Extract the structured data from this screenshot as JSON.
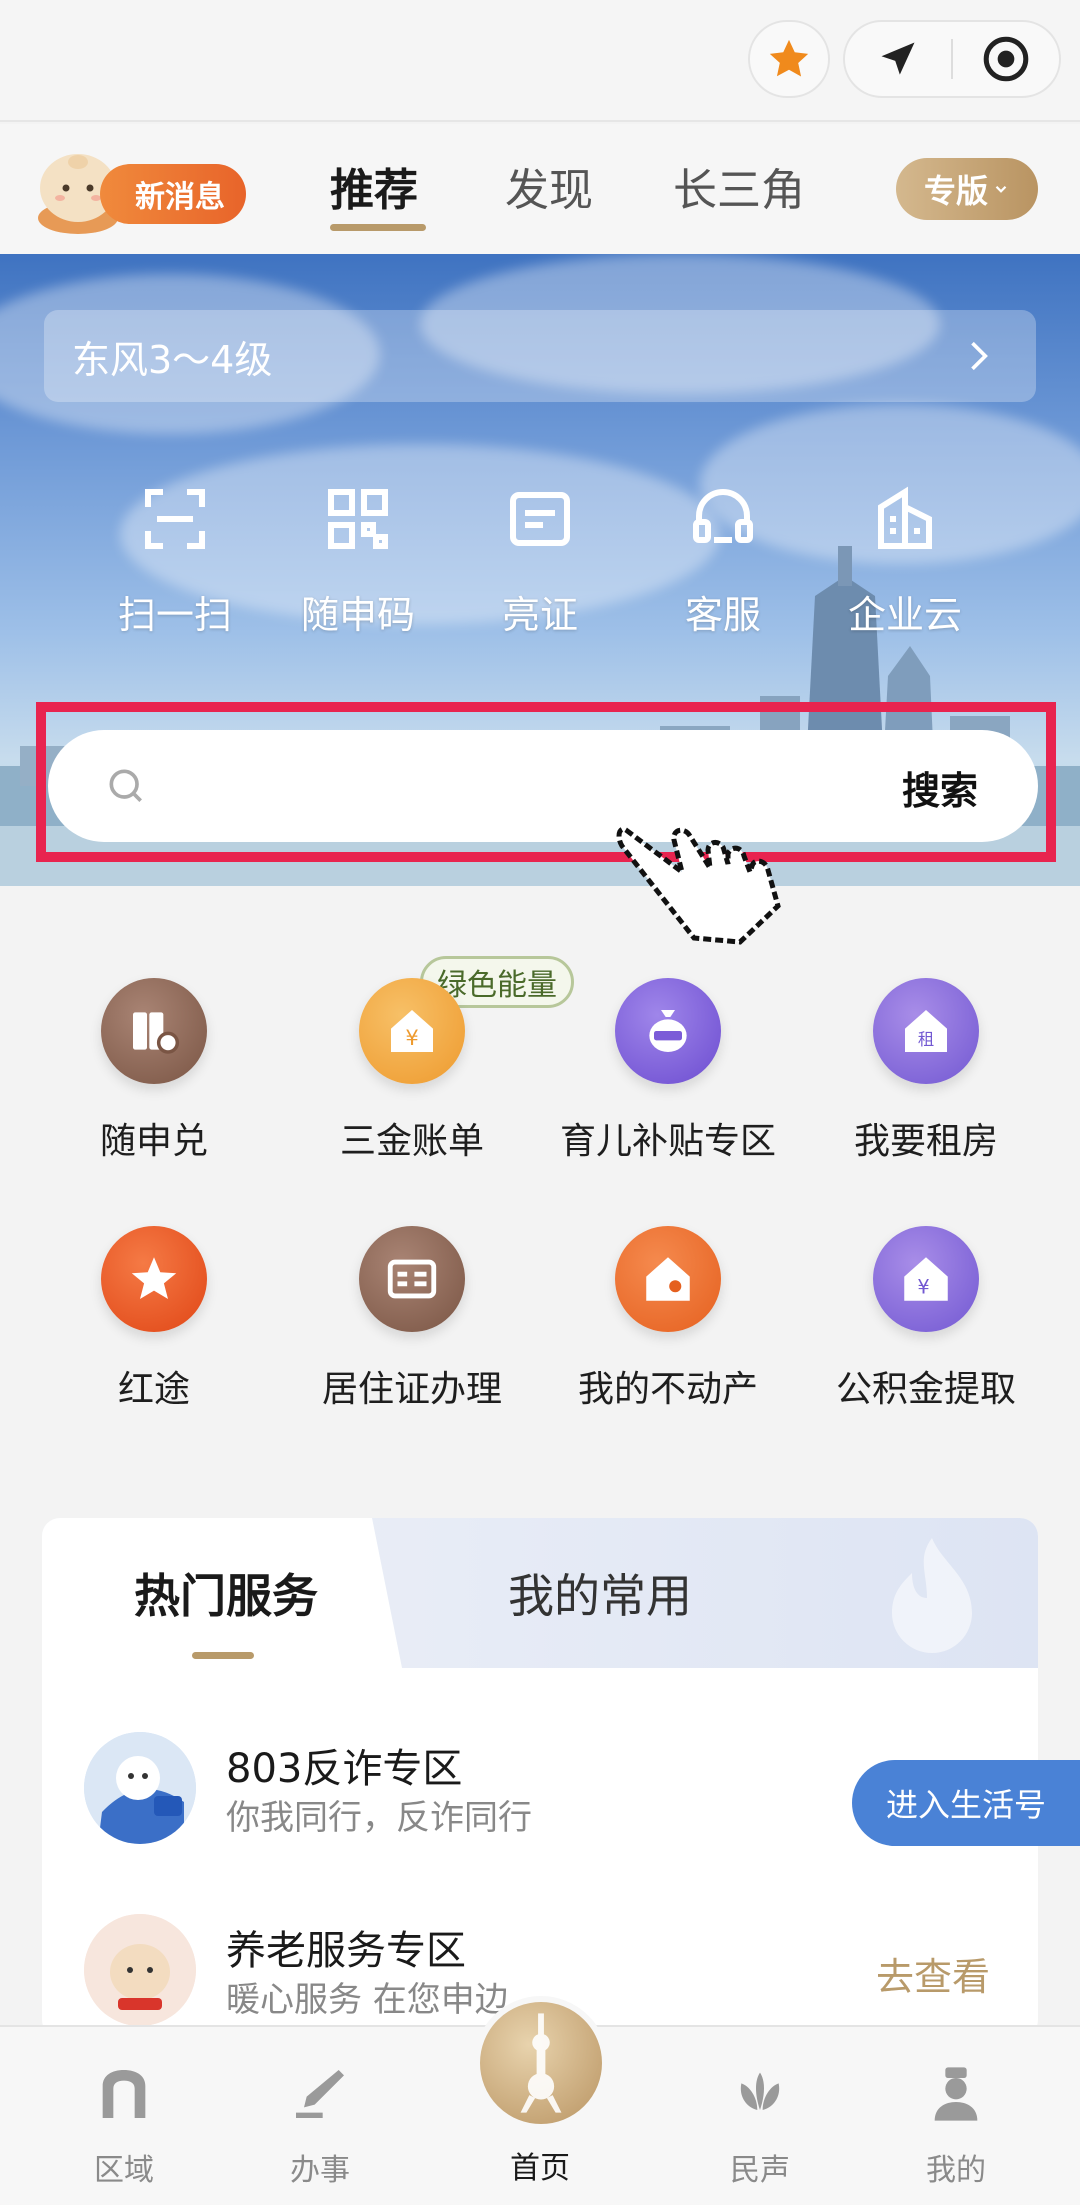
{
  "topbar": {
    "favorite_icon": "star-icon",
    "location_icon": "location-arrow-icon",
    "record_icon": "target-icon"
  },
  "header": {
    "new_message": "新消息",
    "tabs": [
      {
        "label": "推荐",
        "active": true
      },
      {
        "label": "发现",
        "active": false
      },
      {
        "label": "长三角",
        "active": false
      }
    ],
    "edition": "专版"
  },
  "hero": {
    "weather_text": "东风3～4级",
    "quick_actions": [
      {
        "label": "扫一扫",
        "icon": "scan-icon"
      },
      {
        "label": "随申码",
        "icon": "qr-code-icon"
      },
      {
        "label": "亮证",
        "icon": "card-icon"
      },
      {
        "label": "客服",
        "icon": "headset-icon"
      },
      {
        "label": "企业云",
        "icon": "building-icon"
      }
    ],
    "search_placeholder": "",
    "search_button": "搜索"
  },
  "services": {
    "badge": "绿色能量",
    "items": [
      {
        "label": "随申兑",
        "icon": "voucher-icon",
        "color": "#8a6350"
      },
      {
        "label": "三金账单",
        "icon": "yuan-house-icon",
        "color": "#f0a43a"
      },
      {
        "label": "育儿补贴专区",
        "icon": "money-bag-icon",
        "color": "#7e5fd6"
      },
      {
        "label": "我要租房",
        "icon": "rent-house-icon",
        "color": "#8a6ad8"
      },
      {
        "label": "红途",
        "icon": "red-star-icon",
        "color": "#e8501e"
      },
      {
        "label": "居住证办理",
        "icon": "residence-card-icon",
        "color": "#8a6350"
      },
      {
        "label": "我的不动产",
        "icon": "property-icon",
        "color": "#ec6a2a"
      },
      {
        "label": "公积金提取",
        "icon": "fund-house-icon",
        "color": "#7e5fd6"
      }
    ]
  },
  "card": {
    "tabs": [
      "热门服务",
      "我的常用"
    ],
    "rows": [
      {
        "title": "803反诈专区",
        "subtitle": "你我同行，反诈同行",
        "action": "进入生活号"
      },
      {
        "title": "养老服务专区",
        "subtitle": "暖心服务 在您申边",
        "action": "去查看"
      }
    ]
  },
  "bottom_nav": [
    {
      "label": "区域",
      "icon": "region-icon"
    },
    {
      "label": "办事",
      "icon": "pen-icon"
    },
    {
      "label": "首页",
      "icon": "home-tower-icon"
    },
    {
      "label": "民声",
      "icon": "lotus-icon"
    },
    {
      "label": "我的",
      "icon": "profile-icon"
    }
  ]
}
